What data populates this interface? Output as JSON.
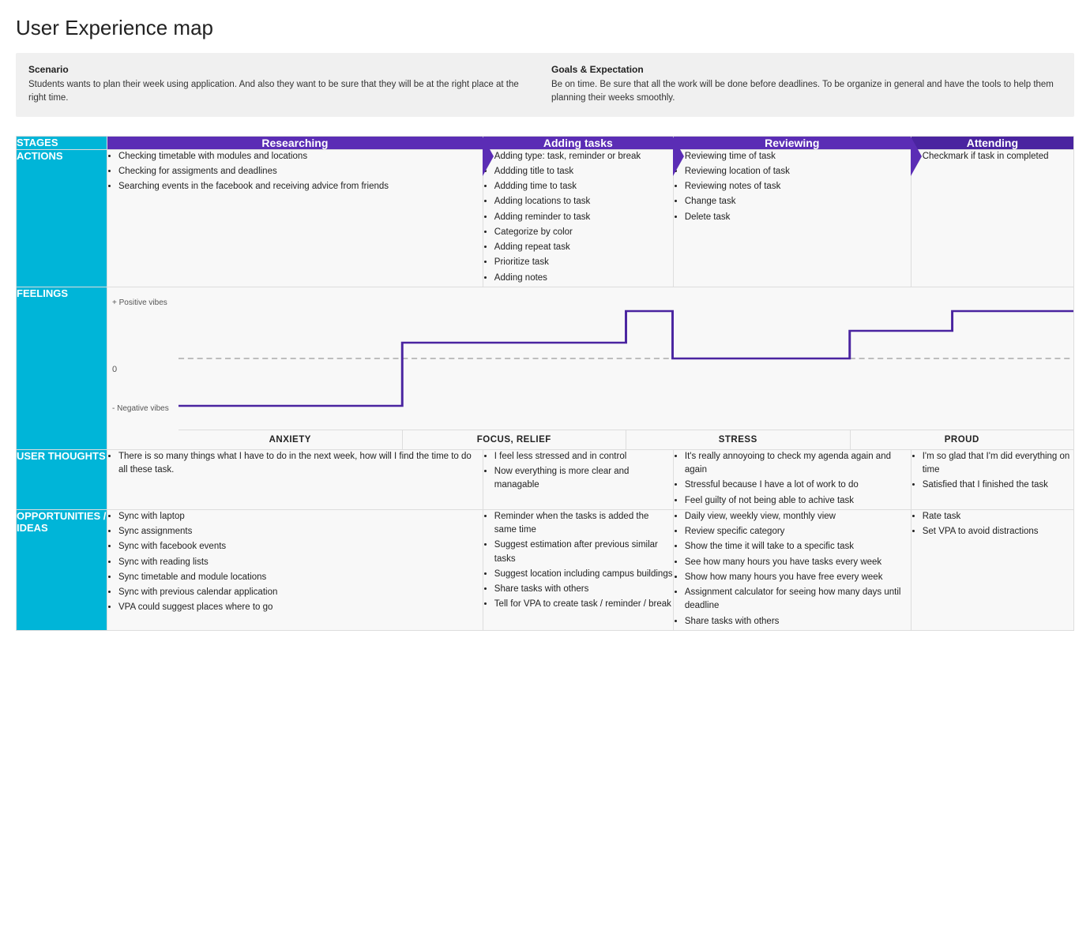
{
  "title": "User Experience map",
  "info": {
    "scenario_label": "Scenario",
    "scenario_text": "Students wants to plan their week using application. And also they want to be sure that they will be at the right place at the right time.",
    "goals_label": "Goals & Expectation",
    "goals_text": "Be on time. Be sure that all the work will be done before deadlines. To be organize in general and have the tools to help them planning their weeks smoothly."
  },
  "stages": {
    "label": "STAGES",
    "items": [
      "Researching",
      "Adding tasks",
      "Reviewing",
      "Attending"
    ]
  },
  "actions": {
    "label": "ACTIONS",
    "cols": [
      [
        "Checking timetable with modules and locations",
        "Checking for assigments and deadlines",
        "Searching events in the facebook and receiving advice from friends"
      ],
      [
        "Adding type: task, reminder or break",
        "Addding title to task",
        "Addding time to task",
        "Adding locations to task",
        "Adding reminder to task",
        "Categorize by color",
        "Adding repeat task",
        "Prioritize task",
        "Adding notes"
      ],
      [
        "Reviewing time of task",
        "Reviewing location of task",
        "Reviewing notes of task",
        "Change task",
        "Delete task"
      ],
      [
        "Checkmark if task in completed"
      ]
    ]
  },
  "feelings": {
    "label": "FEELINGS",
    "pos_label": "+ Positive vibes",
    "neg_label": "- Negative vibes",
    "zero_label": "0",
    "emotions": [
      "ANXIETY",
      "FOCUS, RELIEF",
      "STRESS",
      "PROUD"
    ]
  },
  "user_thoughts": {
    "label": "USER THOUGHTS",
    "cols": [
      [
        "There is so many things what I have to do in the next week, how will I find the time to do all these task."
      ],
      [
        "I feel less stressed and in control",
        "Now everything is more clear and managable"
      ],
      [
        "It's really annoyoing to check my agenda again and again",
        "Stressful because I have a lot of work to do",
        "Feel guilty of not being able to achive task"
      ],
      [
        "I'm so glad that I'm did everything on time",
        "Satisfied that I finished the task"
      ]
    ]
  },
  "opportunities": {
    "label": "OPPORTUNITIES / IDEAS",
    "cols": [
      [
        "Sync with laptop",
        "Sync assignments",
        "Sync with facebook events",
        "Sync with reading lists",
        "Sync timetable and module locations",
        "Sync with previous calendar application",
        "VPA could suggest places where to go"
      ],
      [
        "Reminder when the tasks is added the same time",
        "Suggest estimation after previous similar tasks",
        "Suggest location including campus buildings",
        "Share tasks with others",
        "Tell for VPA to create task / reminder / break"
      ],
      [
        "Daily view, weekly view, monthly view",
        "Review specific category",
        "Show the time it will take to a specific task",
        "See how many hours you have tasks every week",
        "Show how many hours you have free every week",
        "Assignment calculator for seeing how many days until deadline",
        "Share tasks with others"
      ],
      [
        "Rate task",
        "Set VPA to avoid distractions"
      ]
    ]
  }
}
